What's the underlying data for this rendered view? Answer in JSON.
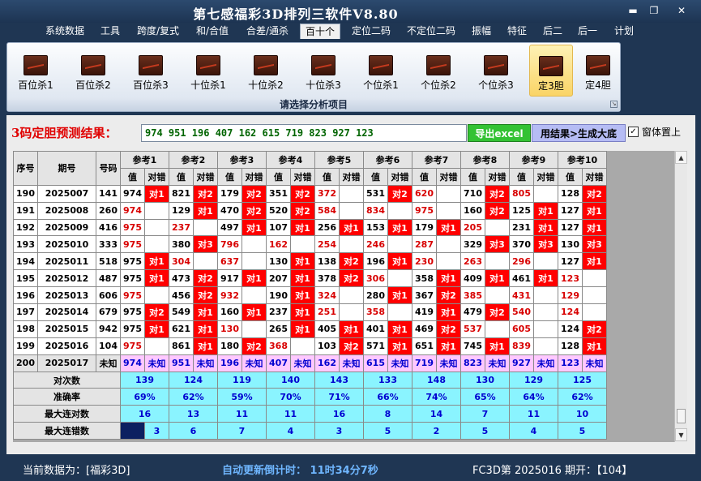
{
  "window": {
    "title": "第七感福彩3D排列三软件V8.80",
    "minimize_glyph": "▬",
    "restore_glyph": "❐",
    "close_glyph": "✕"
  },
  "menu": {
    "items": [
      {
        "label": "系统数据"
      },
      {
        "label": "工具"
      },
      {
        "label": "跨度/复式"
      },
      {
        "label": "和/合值"
      },
      {
        "label": "合差/通杀"
      },
      {
        "label": "百十个",
        "active": true
      },
      {
        "label": "定位二码"
      },
      {
        "label": "不定位二码"
      },
      {
        "label": "振幅"
      },
      {
        "label": "特征"
      },
      {
        "label": "后二"
      },
      {
        "label": "后一"
      },
      {
        "label": "计划"
      }
    ]
  },
  "ribbon": {
    "buttons": [
      {
        "label": "百位杀1"
      },
      {
        "label": "百位杀2"
      },
      {
        "label": "百位杀3"
      },
      {
        "label": "十位杀1"
      },
      {
        "label": "十位杀2"
      },
      {
        "label": "十位杀3"
      },
      {
        "label": "个位杀1"
      },
      {
        "label": "个位杀2"
      },
      {
        "label": "个位杀3"
      },
      {
        "label": "定3胆",
        "active": true
      },
      {
        "label": "定4胆"
      }
    ],
    "caption": "请选择分析项目",
    "icon": "chart-icon",
    "launcher_glyph": "↘"
  },
  "result": {
    "label": "3码定胆预测结果：",
    "value": "974 951 196 407 162 615 719 823 927 123",
    "export_label": "导出excel",
    "base_label": "用结果>生成大底",
    "topmost_checked": true,
    "topmost_check_glyph": "✓",
    "topmost_label": "窗体置上"
  },
  "grid": {
    "headers": {
      "seq": "序号",
      "period": "期号",
      "number": "号码",
      "refs": [
        "参考1",
        "参考2",
        "参考3",
        "参考4",
        "参考5",
        "参考6",
        "参考7",
        "参考8",
        "参考9",
        "参考10"
      ],
      "value": "值",
      "match": "对错"
    },
    "rows": [
      {
        "seq": "190",
        "period": "2025007",
        "number": "141",
        "cells": [
          {
            "v": "974",
            "m": "对1"
          },
          {
            "v": "821",
            "m": "对2"
          },
          {
            "v": "179",
            "m": "对2"
          },
          {
            "v": "351",
            "m": "对2"
          },
          {
            "v": "372",
            "m": "",
            "r": true
          },
          {
            "v": "531",
            "m": "对2"
          },
          {
            "v": "620",
            "m": "",
            "r": true
          },
          {
            "v": "710",
            "m": "对2"
          },
          {
            "v": "805",
            "m": "",
            "r": true
          },
          {
            "v": "128",
            "m": "对2"
          }
        ]
      },
      {
        "seq": "191",
        "period": "2025008",
        "number": "260",
        "cells": [
          {
            "v": "974",
            "m": "",
            "r": true
          },
          {
            "v": "129",
            "m": "对1"
          },
          {
            "v": "470",
            "m": "对2"
          },
          {
            "v": "520",
            "m": "对2"
          },
          {
            "v": "584",
            "m": "",
            "r": true
          },
          {
            "v": "834",
            "m": "",
            "r": true
          },
          {
            "v": "975",
            "m": "",
            "r": true
          },
          {
            "v": "160",
            "m": "对2"
          },
          {
            "v": "125",
            "m": "对1"
          },
          {
            "v": "127",
            "m": "对1"
          }
        ]
      },
      {
        "seq": "192",
        "period": "2025009",
        "number": "416",
        "cells": [
          {
            "v": "975",
            "m": "",
            "r": true
          },
          {
            "v": "237",
            "m": "",
            "r": true
          },
          {
            "v": "497",
            "m": "对1"
          },
          {
            "v": "107",
            "m": "对1"
          },
          {
            "v": "256",
            "m": "对1"
          },
          {
            "v": "153",
            "m": "对1"
          },
          {
            "v": "179",
            "m": "对1"
          },
          {
            "v": "205",
            "m": "",
            "r": true
          },
          {
            "v": "231",
            "m": "对1"
          },
          {
            "v": "127",
            "m": "对1"
          }
        ]
      },
      {
        "seq": "193",
        "period": "2025010",
        "number": "333",
        "cells": [
          {
            "v": "975",
            "m": "",
            "r": true
          },
          {
            "v": "380",
            "m": "对3"
          },
          {
            "v": "796",
            "m": "",
            "r": true
          },
          {
            "v": "162",
            "m": "",
            "r": true
          },
          {
            "v": "254",
            "m": "",
            "r": true
          },
          {
            "v": "246",
            "m": "",
            "r": true
          },
          {
            "v": "287",
            "m": "",
            "r": true
          },
          {
            "v": "329",
            "m": "对3"
          },
          {
            "v": "370",
            "m": "对3"
          },
          {
            "v": "130",
            "m": "对3"
          }
        ]
      },
      {
        "seq": "194",
        "period": "2025011",
        "number": "518",
        "cells": [
          {
            "v": "975",
            "m": "对1"
          },
          {
            "v": "304",
            "m": "",
            "r": true
          },
          {
            "v": "637",
            "m": "",
            "r": true
          },
          {
            "v": "130",
            "m": "对1"
          },
          {
            "v": "138",
            "m": "对2"
          },
          {
            "v": "196",
            "m": "对1"
          },
          {
            "v": "230",
            "m": "",
            "r": true
          },
          {
            "v": "263",
            "m": "",
            "r": true
          },
          {
            "v": "296",
            "m": "",
            "r": true
          },
          {
            "v": "127",
            "m": "对1"
          }
        ]
      },
      {
        "seq": "195",
        "period": "2025012",
        "number": "487",
        "cells": [
          {
            "v": "975",
            "m": "对1"
          },
          {
            "v": "473",
            "m": "对2"
          },
          {
            "v": "917",
            "m": "对1"
          },
          {
            "v": "207",
            "m": "对1"
          },
          {
            "v": "378",
            "m": "对2"
          },
          {
            "v": "306",
            "m": "",
            "r": true
          },
          {
            "v": "358",
            "m": "对1"
          },
          {
            "v": "409",
            "m": "对1"
          },
          {
            "v": "461",
            "m": "对1"
          },
          {
            "v": "123",
            "m": "",
            "r": true
          }
        ]
      },
      {
        "seq": "196",
        "period": "2025013",
        "number": "606",
        "cells": [
          {
            "v": "975",
            "m": "",
            "r": true
          },
          {
            "v": "456",
            "m": "对2"
          },
          {
            "v": "932",
            "m": "",
            "r": true
          },
          {
            "v": "190",
            "m": "对1"
          },
          {
            "v": "324",
            "m": "",
            "r": true
          },
          {
            "v": "280",
            "m": "对1"
          },
          {
            "v": "367",
            "m": "对2"
          },
          {
            "v": "385",
            "m": "",
            "r": true
          },
          {
            "v": "431",
            "m": "",
            "r": true
          },
          {
            "v": "129",
            "m": "",
            "r": true
          }
        ]
      },
      {
        "seq": "197",
        "period": "2025014",
        "number": "679",
        "cells": [
          {
            "v": "975",
            "m": "对2"
          },
          {
            "v": "549",
            "m": "对1"
          },
          {
            "v": "160",
            "m": "对1"
          },
          {
            "v": "237",
            "m": "对1"
          },
          {
            "v": "251",
            "m": "",
            "r": true
          },
          {
            "v": "358",
            "m": "",
            "r": true
          },
          {
            "v": "419",
            "m": "对1"
          },
          {
            "v": "479",
            "m": "对2"
          },
          {
            "v": "540",
            "m": "",
            "r": true
          },
          {
            "v": "124",
            "m": "",
            "r": true
          }
        ]
      },
      {
        "seq": "198",
        "period": "2025015",
        "number": "942",
        "cells": [
          {
            "v": "975",
            "m": "对1"
          },
          {
            "v": "621",
            "m": "对1"
          },
          {
            "v": "130",
            "m": "",
            "r": true
          },
          {
            "v": "265",
            "m": "对1"
          },
          {
            "v": "405",
            "m": "对1"
          },
          {
            "v": "401",
            "m": "对1"
          },
          {
            "v": "469",
            "m": "对2"
          },
          {
            "v": "537",
            "m": "",
            "r": true
          },
          {
            "v": "605",
            "m": "",
            "r": true
          },
          {
            "v": "124",
            "m": "对2"
          }
        ]
      },
      {
        "seq": "199",
        "period": "2025016",
        "number": "104",
        "cells": [
          {
            "v": "975",
            "m": "",
            "r": true
          },
          {
            "v": "861",
            "m": "对1"
          },
          {
            "v": "180",
            "m": "对2"
          },
          {
            "v": "368",
            "m": "",
            "r": true
          },
          {
            "v": "103",
            "m": "对2"
          },
          {
            "v": "571",
            "m": "对1"
          },
          {
            "v": "651",
            "m": "对1"
          },
          {
            "v": "745",
            "m": "对1"
          },
          {
            "v": "839",
            "m": "",
            "r": true
          },
          {
            "v": "128",
            "m": "对1"
          }
        ]
      },
      {
        "seq": "200",
        "period": "2025017",
        "number": "未知",
        "pending": true,
        "cells": [
          {
            "v": "974",
            "m": "未知"
          },
          {
            "v": "951",
            "m": "未知"
          },
          {
            "v": "196",
            "m": "未知"
          },
          {
            "v": "407",
            "m": "未知"
          },
          {
            "v": "162",
            "m": "未知"
          },
          {
            "v": "615",
            "m": "未知"
          },
          {
            "v": "719",
            "m": "未知"
          },
          {
            "v": "823",
            "m": "未知"
          },
          {
            "v": "927",
            "m": "未知"
          },
          {
            "v": "123",
            "m": "未知"
          }
        ]
      }
    ],
    "stats": [
      {
        "label": "对次数",
        "values": [
          "139",
          "124",
          "119",
          "140",
          "143",
          "133",
          "148",
          "130",
          "129",
          "125"
        ]
      },
      {
        "label": "准确率",
        "values": [
          "69%",
          "62%",
          "59%",
          "70%",
          "71%",
          "66%",
          "74%",
          "65%",
          "64%",
          "62%"
        ]
      },
      {
        "label": "最大连对数",
        "values": [
          "16",
          "13",
          "11",
          "11",
          "16",
          "8",
          "14",
          "7",
          "11",
          "10"
        ]
      },
      {
        "label": "最大连错数",
        "values": [
          "3",
          "6",
          "7",
          "4",
          "3",
          "5",
          "2",
          "5",
          "4",
          "5"
        ]
      }
    ]
  },
  "scrollbar": {
    "up_glyph": "▲",
    "down_glyph": "▼"
  },
  "status": {
    "source": "当前数据为：[福彩3D]",
    "countdown": "自动更新倒计时： 11时34分7秒",
    "period": "FC3D第 2025016 期开：【104】"
  },
  "colors": {
    "hit": "#ff0000",
    "miss_value": "#d80000",
    "pending_row": "#ffc8ff",
    "stats_row": "#8af4ff",
    "export_button": "#33c233",
    "base_button": "#b6bcf4"
  }
}
